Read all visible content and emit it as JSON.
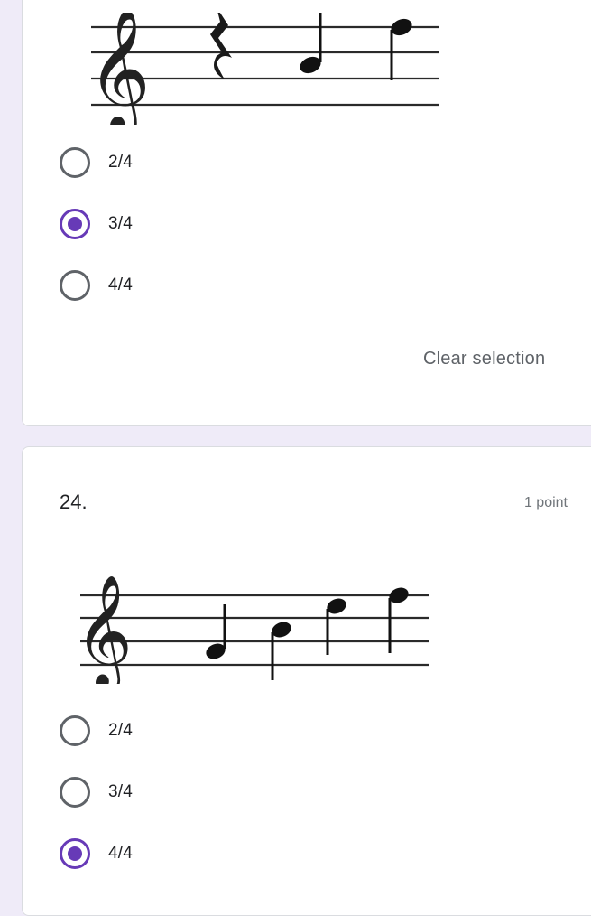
{
  "colors": {
    "page_background": "#efebf8",
    "accent": "#673ab7",
    "radio_unchecked": "#5f6368"
  },
  "question_23": {
    "image": "treble-clef-staff-rest-two-notes",
    "options": [
      {
        "label": "2/4",
        "selected": false
      },
      {
        "label": "3/4",
        "selected": true
      },
      {
        "label": "4/4",
        "selected": false
      }
    ],
    "clear_selection": "Clear selection"
  },
  "question_24": {
    "number": "24.",
    "points": "1 point",
    "image": "treble-clef-staff-four-notes",
    "options": [
      {
        "label": "2/4",
        "selected": false
      },
      {
        "label": "3/4",
        "selected": false
      },
      {
        "label": "4/4",
        "selected": true
      }
    ]
  }
}
